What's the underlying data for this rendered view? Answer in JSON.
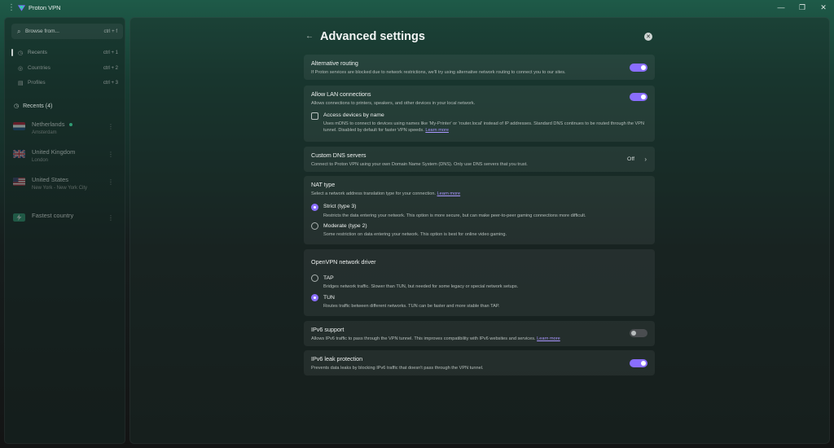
{
  "window": {
    "title": "Proton VPN",
    "controls": {
      "minimize": "—",
      "maximize": "❐",
      "close": "✕"
    }
  },
  "sidebar": {
    "search": {
      "placeholder": "Browse from...",
      "shortcut": "ctrl + f"
    },
    "nav": [
      {
        "label": "Recents",
        "shortcut": "ctrl + 1",
        "icon": "clock-icon"
      },
      {
        "label": "Countries",
        "shortcut": "ctrl + 2",
        "icon": "globe-icon"
      },
      {
        "label": "Profiles",
        "shortcut": "ctrl + 3",
        "icon": "profile-icon"
      }
    ],
    "recents_heading": "Recents (4)",
    "recents": [
      {
        "name": "Netherlands",
        "sub": "Amsterdam",
        "flag": "netherlands"
      },
      {
        "name": "United Kingdom",
        "sub": "London",
        "flag": "uk"
      },
      {
        "name": "United States",
        "sub": "New York - New York City",
        "flag": "us"
      },
      {
        "name": "Fastest country",
        "sub": "",
        "flag": "fastest"
      }
    ]
  },
  "page": {
    "title": "Advanced settings",
    "back_icon": "←",
    "close_icon": "✕"
  },
  "settings": {
    "alt_routing": {
      "title": "Alternative routing",
      "desc": "If Proton services are blocked due to network restrictions, we'll try using alternative network routing to connect you to our sites.",
      "enabled": true
    },
    "lan": {
      "title": "Allow LAN connections",
      "desc": "Allows connections to printers, speakers, and other devices in your local network.",
      "enabled": true,
      "access_by_name": {
        "title": "Access devices by name",
        "desc": "Uses mDNS to connect to devices using names like 'My-Printer' or 'router.local' instead of IP addresses. Standard DNS continues to be routed through the VPN tunnel. Disabled by default for faster VPN speeds.",
        "link": "Learn more",
        "checked": false
      }
    },
    "dns": {
      "title": "Custom DNS servers",
      "desc": "Connect to Proton VPN using your own Domain Name System (DNS). Only use DNS servers that you trust.",
      "value": "Off"
    },
    "nat": {
      "title": "NAT type",
      "desc": "Select a network address translation type for your connection.",
      "link": "Learn more",
      "options": [
        {
          "label": "Strict (type 3)",
          "desc": "Restricts the data entering your network. This option is more secure, but can make peer-to-peer gaming connections more difficult.",
          "selected": true
        },
        {
          "label": "Moderate (type 2)",
          "desc": "Some restriction on data entering your network. This option is best for online video gaming.",
          "selected": false
        }
      ]
    },
    "openvpn": {
      "title": "OpenVPN network driver",
      "options": [
        {
          "label": "TAP",
          "desc": "Bridges network traffic. Slower than TUN, but needed for some legacy or special network setups.",
          "selected": false
        },
        {
          "label": "TUN",
          "desc": "Routes traffic between different networks. TUN can be faster and more stable than TAP.",
          "selected": true
        }
      ]
    },
    "ipv6": {
      "title": "IPv6 support",
      "desc": "Allows IPv6 traffic to pass through the VPN tunnel. This improves compatibility with IPv6 websites and services.",
      "link": "Learn more",
      "enabled": false
    },
    "ipv6_leak": {
      "title": "IPv6 leak protection",
      "desc": "Prevents data leaks by blocking IPv6 traffic that doesn't pass through the VPN tunnel.",
      "enabled": true
    }
  },
  "colors": {
    "accent": "#8a6eff",
    "link": "#a996ff",
    "active_dot": "#2f9b73"
  }
}
